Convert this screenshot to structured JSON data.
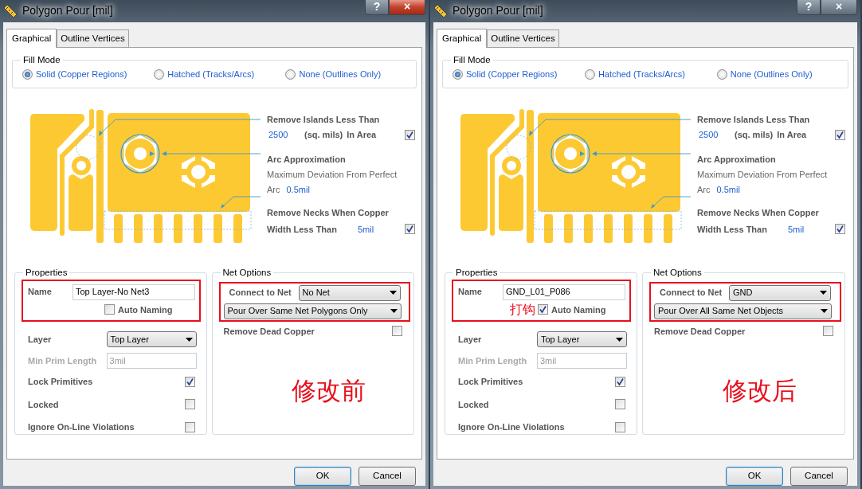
{
  "dialogs": [
    {
      "title": "Polygon Pour [mil]",
      "active": true,
      "help": "?",
      "close": "×",
      "tabs": [
        {
          "label": "Graphical",
          "selected": true
        },
        {
          "label": "Outline Vertices",
          "selected": false
        }
      ],
      "fill_mode": {
        "title": "Fill Mode",
        "options": [
          {
            "label": "Solid (Copper Regions)",
            "selected": true
          },
          {
            "label": "Hatched (Tracks/Arcs)",
            "selected": false
          },
          {
            "label": "None (Outlines Only)",
            "selected": false
          }
        ]
      },
      "islands": {
        "label": "Remove Islands Less Than",
        "value": "2500",
        "unit": "(sq. mils)",
        "in_area": "In Area",
        "checked": true
      },
      "arc": {
        "label": "Arc Approximation",
        "description": "Maximum Deviation From Perfect",
        "arc_label": "Arc",
        "value": "0.5mil"
      },
      "necks": {
        "label": "Remove Necks When Copper",
        "width_label": "Width Less Than",
        "value": "5mil",
        "checked": true
      },
      "properties": {
        "title": "Properties",
        "highlighted": true,
        "name_label": "Name",
        "name_value": "Top Layer-No Net3",
        "auto_naming": {
          "label": "Auto Naming",
          "checked": false
        },
        "layer_label": "Layer",
        "layer_value": "Top Layer",
        "min_prim": {
          "label": "Min Prim Length",
          "value": "3mil",
          "disabled": true
        },
        "checks": [
          {
            "label": "Lock Primitives",
            "checked": true
          },
          {
            "label": "Locked",
            "checked": false
          },
          {
            "label": "Ignore On-Line Violations",
            "checked": false
          }
        ]
      },
      "net_options": {
        "title": "Net Options",
        "highlighted": true,
        "connect_label": "Connect to Net",
        "connect_value": "No Net",
        "pour_value": "Pour Over Same Net Polygons Only",
        "dead_copper": {
          "label": "Remove Dead Copper",
          "checked": false
        }
      },
      "annotation": "修改前",
      "buttons": [
        {
          "label": "OK",
          "default": true
        },
        {
          "label": "Cancel",
          "default": false
        }
      ]
    },
    {
      "title": "Polygon Pour [mil]",
      "active": false,
      "help": "?",
      "close": "×",
      "tabs": [
        {
          "label": "Graphical",
          "selected": true
        },
        {
          "label": "Outline Vertices",
          "selected": false
        }
      ],
      "fill_mode": {
        "title": "Fill Mode",
        "options": [
          {
            "label": "Solid (Copper Regions)",
            "selected": true
          },
          {
            "label": "Hatched (Tracks/Arcs)",
            "selected": false
          },
          {
            "label": "None (Outlines Only)",
            "selected": false
          }
        ]
      },
      "islands": {
        "label": "Remove Islands Less Than",
        "value": "2500",
        "unit": "(sq. mils)",
        "in_area": "In Area",
        "checked": true
      },
      "arc": {
        "label": "Arc Approximation",
        "description": "Maximum Deviation From Perfect",
        "arc_label": "Arc",
        "value": "0.5mil"
      },
      "necks": {
        "label": "Remove Necks When Copper",
        "width_label": "Width Less Than",
        "value": "5mil",
        "checked": true
      },
      "properties": {
        "title": "Properties",
        "highlighted": true,
        "name_label": "Name",
        "name_value": "GND_L01_P086",
        "auto_naming": {
          "label": "Auto Naming",
          "checked": true,
          "note": "打钩"
        },
        "layer_label": "Layer",
        "layer_value": "Top Layer",
        "min_prim": {
          "label": "Min Prim Length",
          "value": "3mil",
          "disabled": true
        },
        "checks": [
          {
            "label": "Lock Primitives",
            "checked": true
          },
          {
            "label": "Locked",
            "checked": false
          },
          {
            "label": "Ignore On-Line Violations",
            "checked": false
          }
        ]
      },
      "net_options": {
        "title": "Net Options",
        "highlighted": true,
        "connect_label": "Connect to Net",
        "connect_value": "GND",
        "pour_value": "Pour Over All Same Net Objects",
        "dead_copper": {
          "label": "Remove Dead Copper",
          "checked": false
        }
      },
      "annotation": "修改后",
      "buttons": [
        {
          "label": "OK",
          "default": true
        },
        {
          "label": "Cancel",
          "default": false
        }
      ]
    }
  ]
}
